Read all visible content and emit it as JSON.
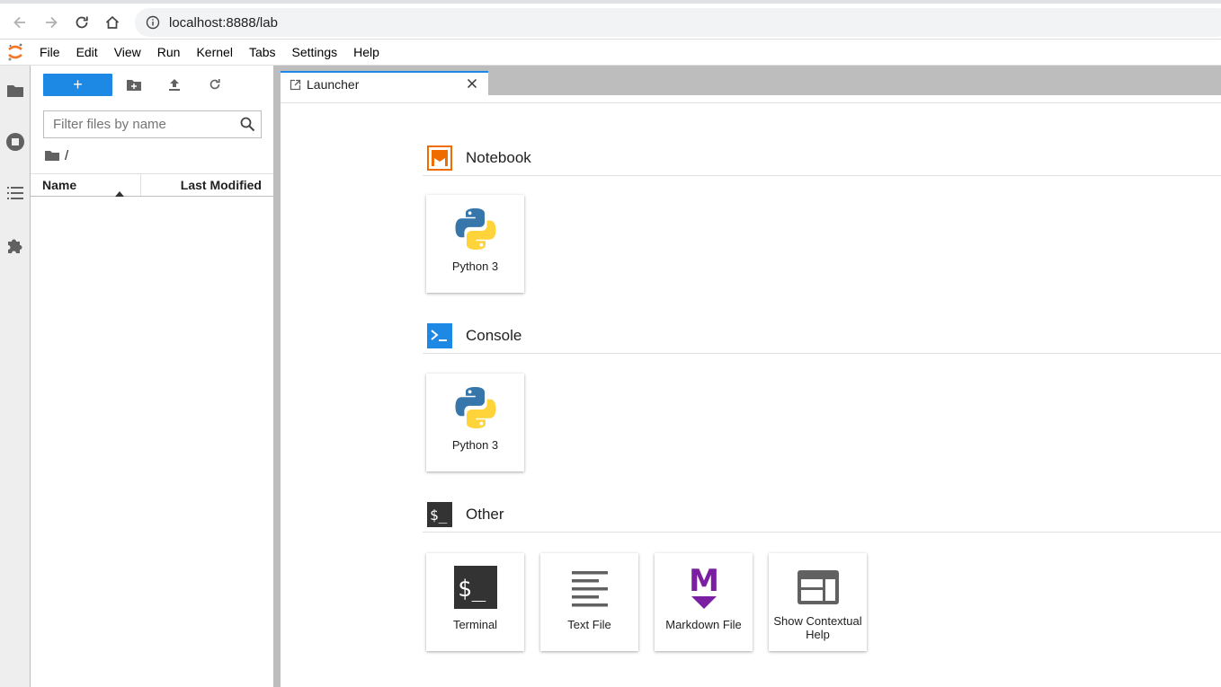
{
  "browser": {
    "url": "localhost:8888/lab"
  },
  "menubar": {
    "items": [
      "File",
      "Edit",
      "View",
      "Run",
      "Kernel",
      "Tabs",
      "Settings",
      "Help"
    ]
  },
  "filebrowser": {
    "new_label": "+",
    "filter_placeholder": "Filter files by name",
    "breadcrumb": "/",
    "columns": {
      "name": "Name",
      "modified": "Last Modified"
    }
  },
  "tabs": [
    {
      "label": "Launcher",
      "active": true
    }
  ],
  "launcher": {
    "sections": [
      {
        "title": "Notebook",
        "icon": "notebook-icon",
        "color": "#ef6c00",
        "items": [
          {
            "label": "Python 3",
            "icon": "python-logo"
          }
        ]
      },
      {
        "title": "Console",
        "icon": "console-icon",
        "color": "#1e88e5",
        "items": [
          {
            "label": "Python 3",
            "icon": "python-logo"
          }
        ]
      },
      {
        "title": "Other",
        "icon": "other-icon",
        "color": "#333333",
        "items": [
          {
            "label": "Terminal",
            "icon": "terminal-icon"
          },
          {
            "label": "Text File",
            "icon": "text-file-icon"
          },
          {
            "label": "Markdown File",
            "icon": "markdown-icon"
          },
          {
            "label": "Show Contextual Help",
            "icon": "contextual-help-icon"
          }
        ]
      }
    ]
  },
  "colors": {
    "accent": "#1e88e5",
    "notebook": "#ef6c00",
    "markdown": "#7b1fa2"
  }
}
